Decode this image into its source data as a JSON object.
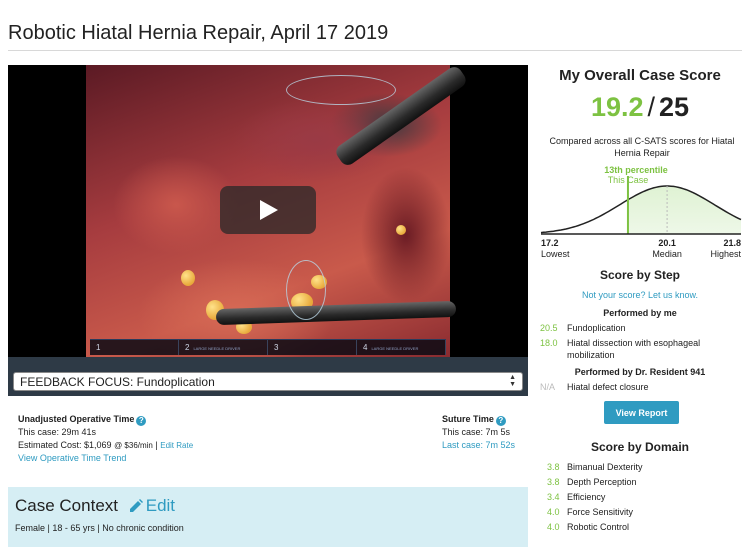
{
  "page": {
    "title": "Robotic Hiatal Hernia Repair, April 17 2019"
  },
  "video": {
    "segments": [
      {
        "num": "1",
        "label": ""
      },
      {
        "num": "2",
        "label": "LARGE NEEDLE DRIVER"
      },
      {
        "num": "3",
        "label": ""
      },
      {
        "num": "4",
        "label": "LARGE NEEDLE DRIVER"
      }
    ]
  },
  "focus": {
    "selected": "FEEDBACK FOCUS: Fundoplication"
  },
  "operative_time": {
    "heading": "Unadjusted Operative Time",
    "this_case": "This case: 29m 41s",
    "estimated_cost": "Estimated Cost: $1,069",
    "rate": "@ $36/min",
    "edit_rate": "Edit Rate",
    "trend_link": "View Operative Time Trend"
  },
  "suture_time": {
    "heading": "Suture Time",
    "this_case": "This case: 7m 5s",
    "last_case": "Last case: 7m 52s"
  },
  "case_context": {
    "title": "Case Context",
    "edit": "Edit",
    "details": "Female | 18 - 65 yrs | No chronic condition"
  },
  "overall": {
    "heading": "My Overall Case Score",
    "score": "19.2",
    "slash": "/",
    "max": "25",
    "compared": "Compared across all C-SATS scores for Hiatal Hernia Repair"
  },
  "distribution": {
    "percentile": "13th percentile",
    "this_case": "This Case",
    "lowest_val": "17.2",
    "lowest": "Lowest",
    "median_val": "20.1",
    "median": "Median",
    "highest_val": "21.8",
    "highest": "Highest",
    "range": [
      17.2,
      21.8
    ],
    "median_value": 20.1,
    "case_value": 19.2,
    "accent": "#7dc242"
  },
  "score_by_step": {
    "heading": "Score by Step",
    "not_your_score": "Not your score? Let us know.",
    "group1": "Performed by me",
    "steps_me": [
      {
        "value": "20.5",
        "label": "Fundoplication"
      },
      {
        "value": "18.0",
        "label": "Hiatal dissection with esophageal mobilization"
      }
    ],
    "group2": "Performed by Dr. Resident 941",
    "steps_resident": [
      {
        "value": "N/A",
        "label": "Hiatal defect closure"
      }
    ],
    "view_report": "View Report"
  },
  "score_by_domain": {
    "heading": "Score by Domain",
    "domains": [
      {
        "value": "3.8",
        "label": "Bimanual Dexterity"
      },
      {
        "value": "3.8",
        "label": "Depth Perception"
      },
      {
        "value": "3.4",
        "label": "Efficiency"
      },
      {
        "value": "4.0",
        "label": "Force Sensitivity"
      },
      {
        "value": "4.0",
        "label": "Robotic Control"
      }
    ]
  },
  "colors": {
    "accent_green": "#7dc242",
    "link_blue": "#2f9bc1",
    "context_bg": "#d6eef4"
  }
}
